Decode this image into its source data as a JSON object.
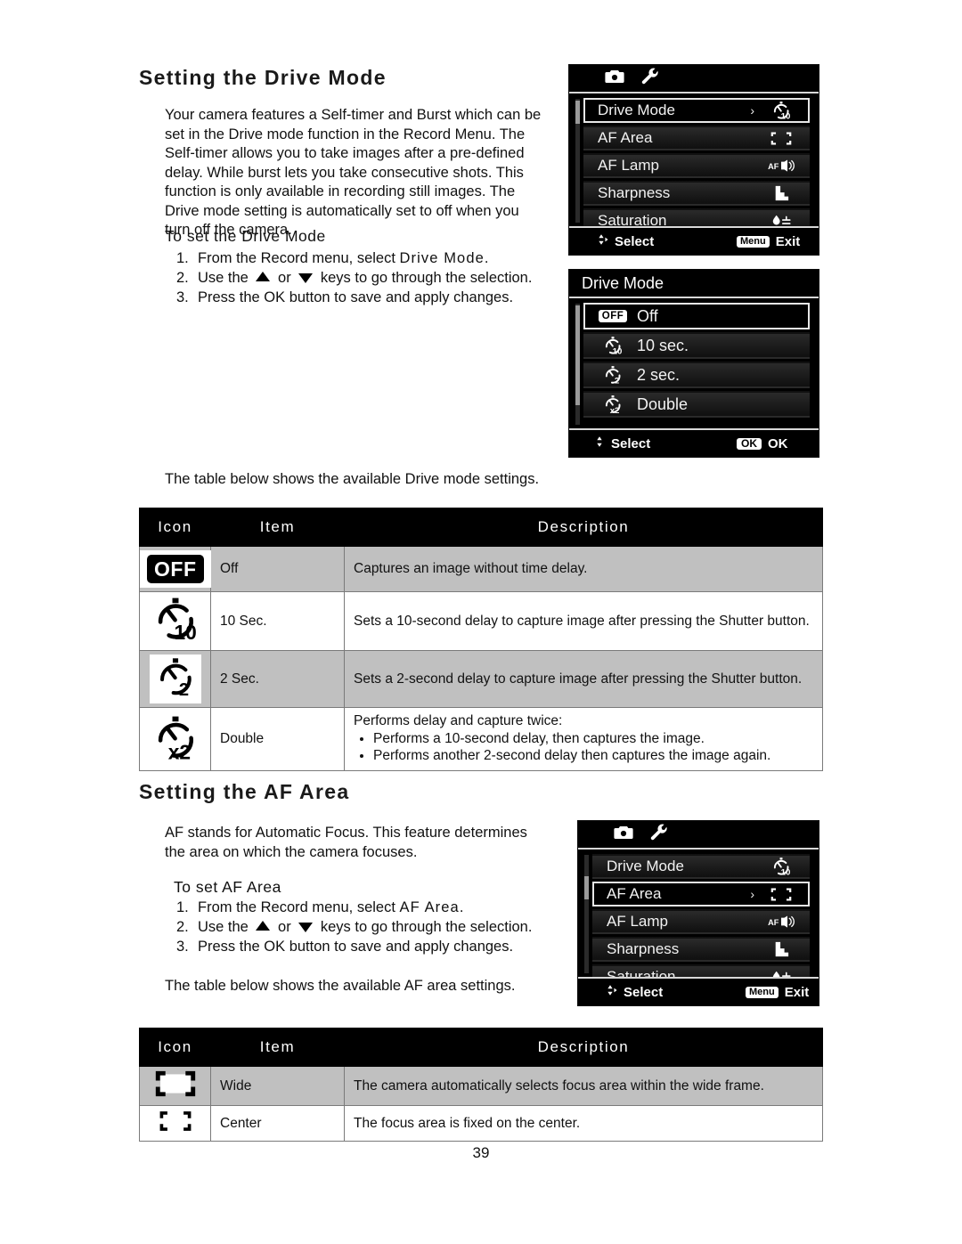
{
  "page": {
    "number": "39"
  },
  "drive_section": {
    "heading": "Setting the Drive Mode",
    "intro": "Your camera features a Self-timer and Burst which can be set in the Drive mode function in the Record Menu. The Self-timer allows you to take images after a pre-defined delay. While burst lets you take consecutive shots. This function is only available in recording still images. The Drive mode setting is automatically set to off when you turn off the camera.",
    "sub_heading": "To set the Drive Mode",
    "steps": [
      {
        "num": "1.",
        "pre": "From the Record menu, select ",
        "emph": "Drive Mode",
        "post": "."
      },
      {
        "num": "2.",
        "pre": "Use the ",
        "mid": " or ",
        "post": " keys to go through the selection."
      },
      {
        "num": "3.",
        "pre": "Press the OK button to save and apply changes."
      }
    ],
    "table_note": "The table below shows the available Drive mode settings."
  },
  "af_section": {
    "heading": "Setting the AF Area",
    "intro": "AF stands for Automatic Focus. This feature determines the area on which the camera focuses.",
    "sub_heading": "To set AF Area",
    "steps": [
      {
        "num": "1.",
        "pre": "From the Record menu, select ",
        "emph": "AF Area",
        "post": "."
      },
      {
        "num": "2.",
        "pre": "Use the ",
        "mid": " or ",
        "post": " keys to go through the selection."
      },
      {
        "num": "3.",
        "pre": "Press the OK button to save and apply changes."
      }
    ],
    "table_note": "The table below shows the available AF area settings."
  },
  "record_menu_lcd_1": {
    "tabs": [
      "camera-icon",
      "wrench-icon"
    ],
    "rows": [
      {
        "label": "Drive Mode",
        "icon": "self-timer-10-icon",
        "selected": true,
        "chevron": "›"
      },
      {
        "label": "AF Area",
        "icon": "af-center-icon",
        "selected": false,
        "chevron": ""
      },
      {
        "label": "AF Lamp",
        "icon": "af-lamp-icon",
        "selected": false,
        "chevron": ""
      },
      {
        "label": "Sharpness",
        "icon": "sharpness-icon",
        "selected": false,
        "chevron": ""
      },
      {
        "label": "Saturation",
        "icon": "saturation-icon",
        "selected": false,
        "chevron": ""
      }
    ],
    "footer": {
      "select_label": "Select",
      "menu_badge": "Menu",
      "exit_label": "Exit"
    }
  },
  "drive_mode_lcd": {
    "title": "Drive Mode",
    "options": [
      {
        "label": "Off",
        "icon": "off-badge-icon",
        "selected": true
      },
      {
        "label": "10 sec.",
        "icon": "self-timer-10-icon",
        "selected": false
      },
      {
        "label": "2 sec.",
        "icon": "self-timer-2-icon",
        "selected": false
      },
      {
        "label": "Double",
        "icon": "self-timer-x2-icon",
        "selected": false
      }
    ],
    "footer": {
      "select_label": "Select",
      "ok_badge": "OK",
      "ok_label": "OK"
    }
  },
  "record_menu_lcd_2": {
    "tabs": [
      "camera-icon",
      "wrench-icon"
    ],
    "rows": [
      {
        "label": "Drive Mode",
        "icon": "self-timer-10-icon",
        "selected": false,
        "chevron": ""
      },
      {
        "label": "AF Area",
        "icon": "af-center-icon",
        "selected": true,
        "chevron": "›"
      },
      {
        "label": "AF Lamp",
        "icon": "af-lamp-icon",
        "selected": false,
        "chevron": ""
      },
      {
        "label": "Sharpness",
        "icon": "sharpness-icon",
        "selected": false,
        "chevron": ""
      },
      {
        "label": "Saturation",
        "icon": "saturation-icon",
        "selected": false,
        "chevron": ""
      }
    ],
    "footer": {
      "select_label": "Select",
      "menu_badge": "Menu",
      "exit_label": "Exit"
    }
  },
  "drive_table": {
    "headers": [
      "Icon",
      "Item",
      "Description"
    ],
    "rows": [
      {
        "icon": "off-badge-icon",
        "item": "Off",
        "description": "Captures an image without time delay.",
        "bullets": []
      },
      {
        "icon": "self-timer-10-icon",
        "item": "10 Sec.",
        "description": "Sets a 10-second delay to capture image after pressing the Shutter button.",
        "bullets": []
      },
      {
        "icon": "self-timer-2-icon",
        "item": "2 Sec.",
        "description": "Sets a 2-second delay to capture image after pressing the Shutter button.",
        "bullets": []
      },
      {
        "icon": "self-timer-x2-icon",
        "item": "Double",
        "description": "Performs delay and capture twice:",
        "bullets": [
          "Performs a 10-second delay, then captures the image.",
          "Performs another 2-second delay then captures the image again."
        ]
      }
    ]
  },
  "af_table": {
    "headers": [
      "Icon",
      "Item",
      "Description"
    ],
    "rows": [
      {
        "icon": "af-wide-icon",
        "item": "Wide",
        "description": "The camera automatically selects focus area within the wide frame.",
        "bullets": []
      },
      {
        "icon": "af-center-icon",
        "item": "Center",
        "description": "The focus area is fixed on the center.",
        "bullets": []
      }
    ]
  }
}
